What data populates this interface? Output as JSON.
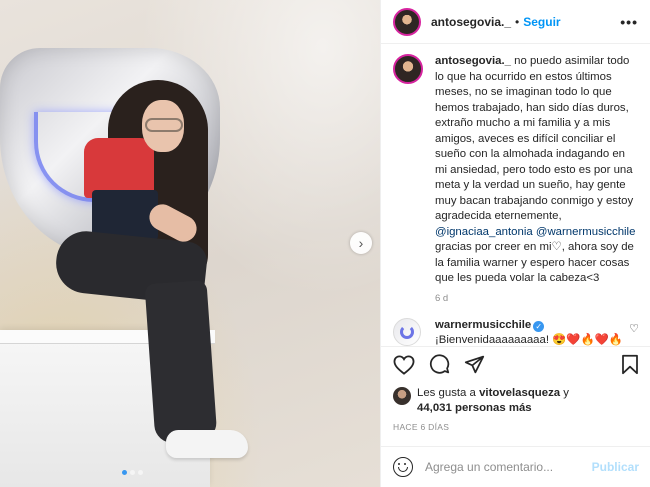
{
  "post": {
    "username": "antosegovia._",
    "separator": "•",
    "follow_label": "Seguir",
    "more_icon": "•••"
  },
  "caption": {
    "username": "antosegovia._",
    "text_part1": "no puedo asimilar todo lo que ha ocurrido en estos últimos meses, no se imaginan todo lo que hemos trabajado, han sido días duros, extraño mucho a mi familia y a mis amigos, aveces es difícil conciliar el sueño con la almohada indagando en mi ansiedad, pero todo esto es por una meta y la verdad un sueño, hay gente muy bacan trabajando conmigo y estoy agradecida eternemente,",
    "mention1": "@ignaciaa_antonia",
    "mention2": "@warnermusicchile",
    "text_part2": "gracias por creer en mi♡, ahora soy de la familia warner y espero hacer cosas que les pueda volar la cabeza<3",
    "time": "6 d"
  },
  "comment": {
    "username": "warnermusicchile",
    "verified_mark": "✓",
    "text": "¡Bienvenidaaaaaaaaa! 😍❤️🔥❤️🔥",
    "like_icon": "♡"
  },
  "likes": {
    "prefix": "Les gusta a",
    "user": "vitovelasqueza",
    "connector": "y",
    "count": "44,031 personas más"
  },
  "date": "HACE 6 DÍAS",
  "add_comment": {
    "placeholder": "Agrega un comentario...",
    "post_label": "Publicar"
  },
  "carousel": {
    "next_icon": "›",
    "total_slides": 3,
    "active_slide": 1
  },
  "colors": {
    "link": "#0095f6",
    "mention": "#00376b",
    "muted": "#8e8e8e",
    "verified": "#3897f0"
  }
}
